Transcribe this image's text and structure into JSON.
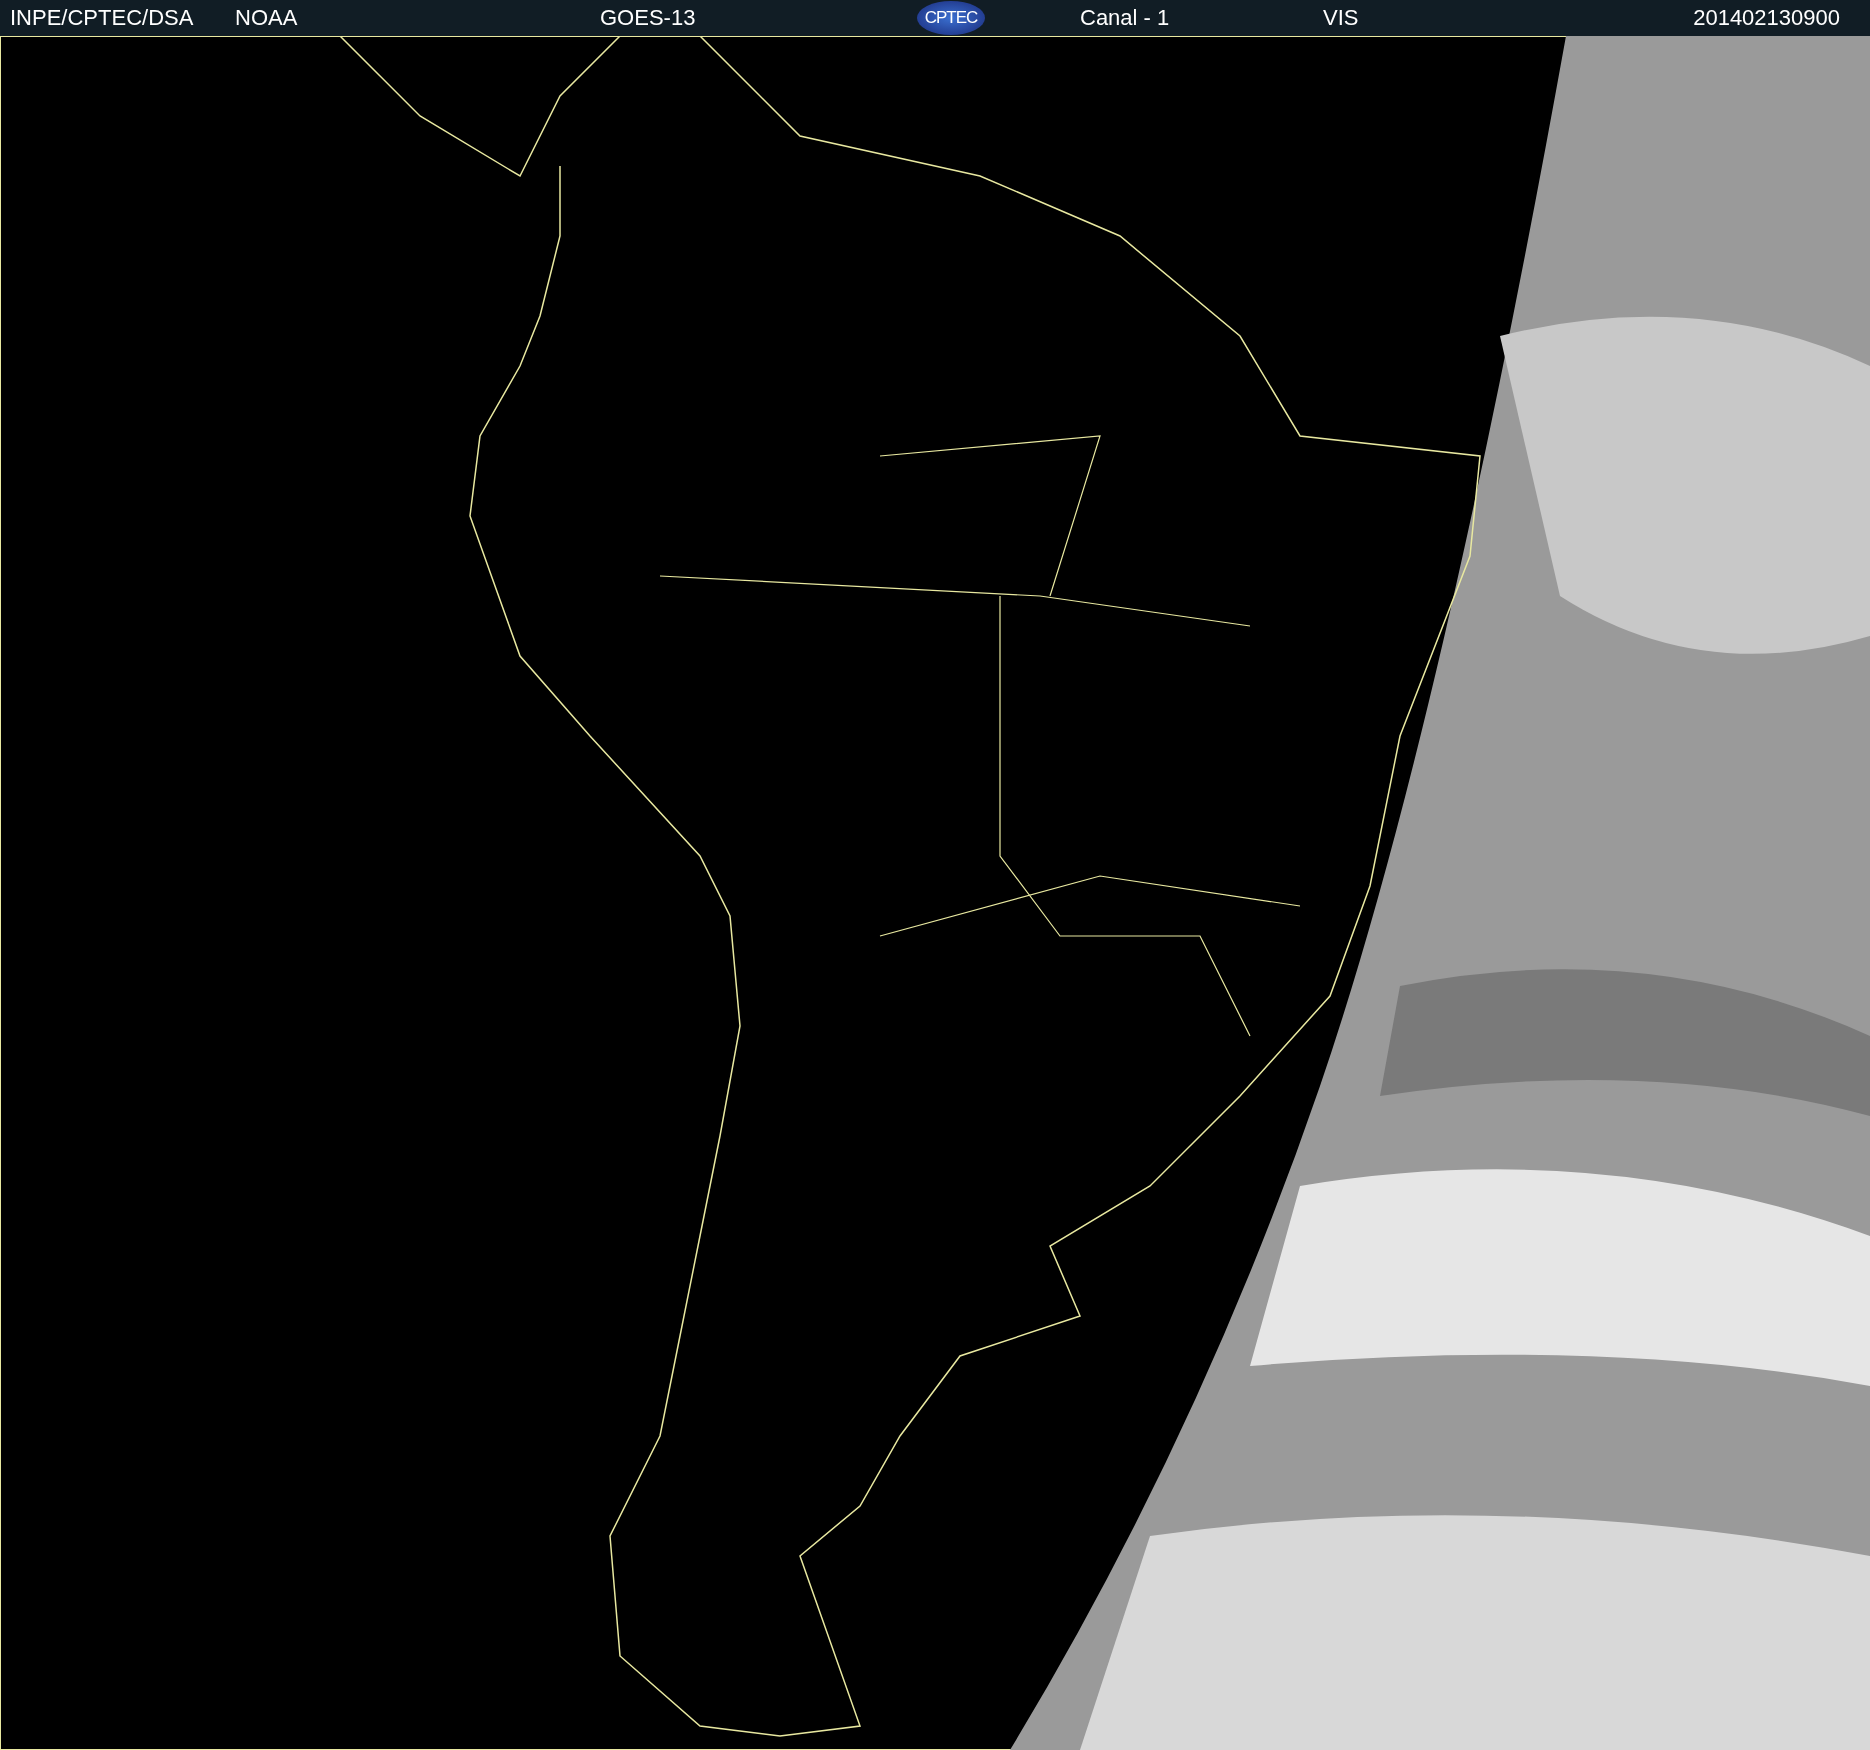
{
  "header": {
    "source": "INPE/CPTEC/DSA",
    "agency": "NOAA",
    "satellite": "GOES-13",
    "logo": "CPTEC",
    "channel": "Canal - 1",
    "band": "VIS",
    "timestamp": "201402130900"
  }
}
